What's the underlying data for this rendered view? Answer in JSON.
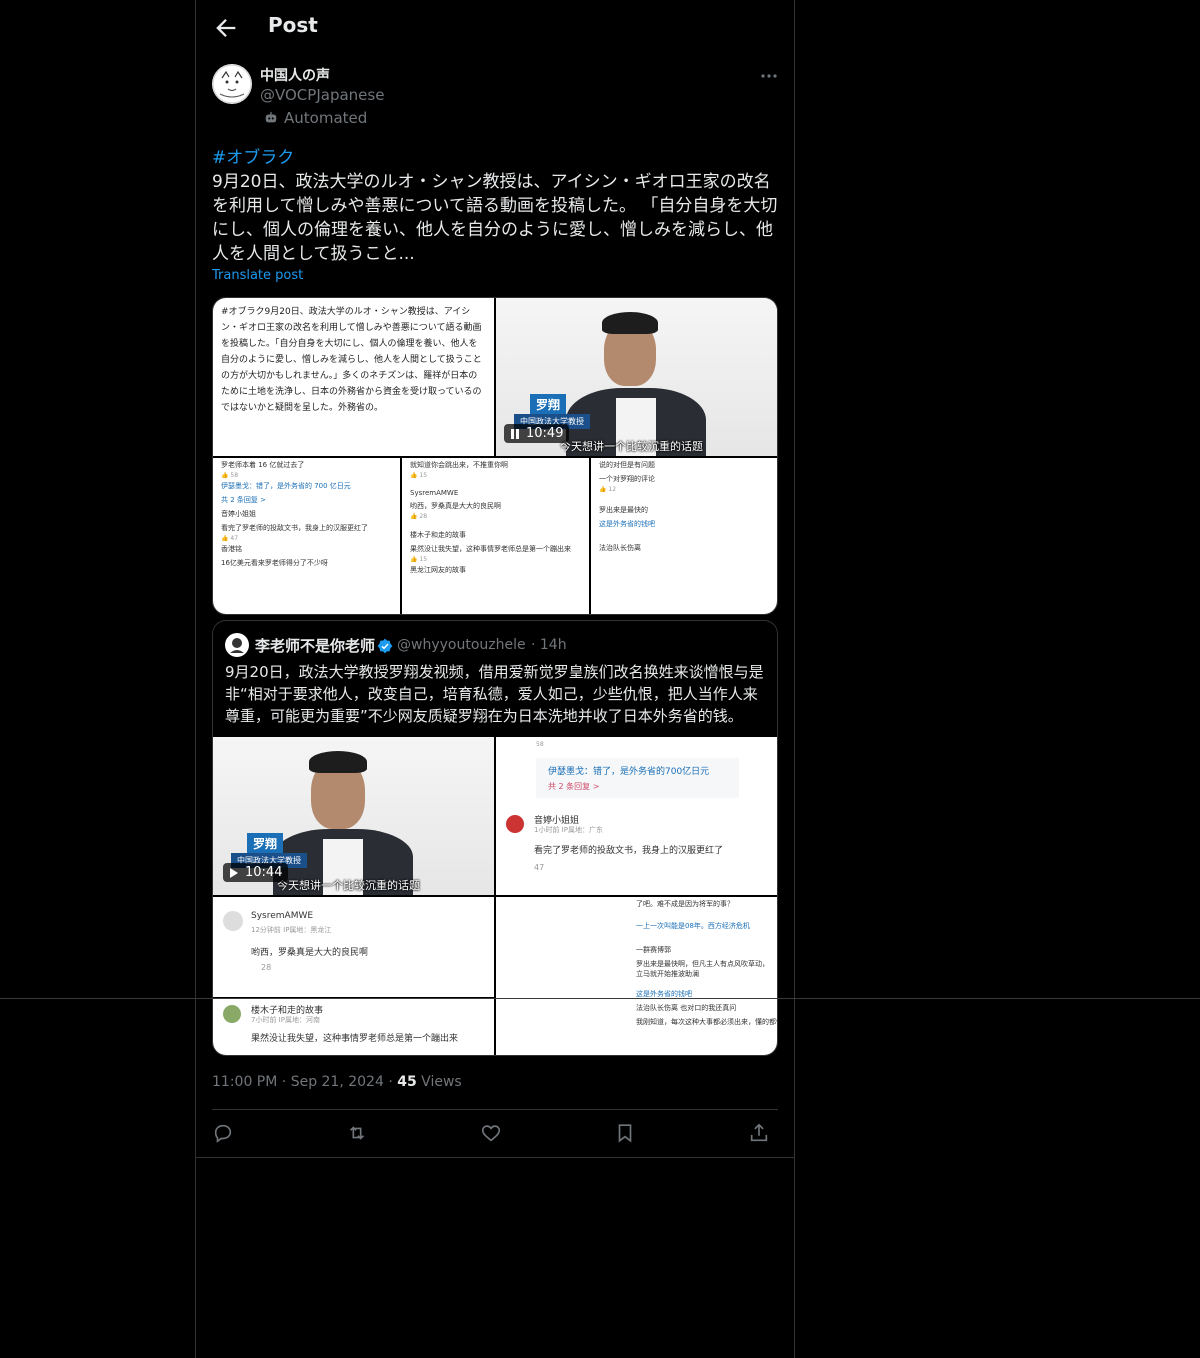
{
  "header": {
    "title": "Post"
  },
  "author": {
    "name": "中国人の声",
    "handle": "@VOCPJapanese",
    "automated_label": "Automated"
  },
  "post": {
    "hashtag": "#オブラク",
    "text": "9月20日、政法大学のルオ・シャン教授は、アイシン・ギオロ王家の改名を利用して憎しみや善悪について語る動画を投稿した。 「自分自身を大切にし、個人の倫理を養い、他人を自分のように愛し、憎しみを減らし、他人を人間として扱うこと...",
    "translate_label": "Translate post"
  },
  "media": {
    "doc_text": "#オブラク9月20日、政法大学のルオ・シャン教授は、アイシン・ギオロ王家の改名を利用して憎しみや善悪について語る動画を投稿した。「自分自身を大切にし、個人の倫理を養い、他人を自分のように愛し、憎しみを減らし、他人を人間として扱うことの方が大切かもしれません。」多くのネチズンは、羅祥が日本のために土地を洗浄し、日本の外務省から資金を受け取っているのではないかと疑問を呈した。外務省の。",
    "video_badge": "罗翔",
    "video_sub": "中国政法大学教授",
    "video_caption": "今天想讲一个比较沉重的话题",
    "video_time": "10:49",
    "comments_a": [
      "罗老师本着 16 亿就过去了",
      "伊瑟墨戈：错了，是外务省的 700 亿日元",
      "共 2 条回复 >",
      "音婷小姐姐",
      "看完了罗老师的投敌文书，我身上的汉服更红了",
      "香港铭",
      "16亿美元看来罗老师得分了不少呀"
    ],
    "comments_b": [
      "就知道你会跳出来，不推重你啊",
      "SysremAMWE",
      "哟西，罗桑真是大大的良民啊",
      "楼木子和走的故事",
      "果然没让我失望，这种事情罗老师总是第一个蹦出来",
      "黑龙江网友的故事"
    ],
    "comments_c": [
      "说的对但是有问题",
      "一个对罗翔的评论",
      "罗出来是最快的",
      "这是外务省的钱吧",
      "法治队长伤离"
    ]
  },
  "quote": {
    "name": "李老师不是你老师",
    "handle": "@whyyoutouzhele",
    "time": "· 14h",
    "text": "9月20日，政法大学教授罗翔发视频，借用爱新觉罗皇族们改名换姓来谈憎恨与是非“相对于要求他人，改变自己，培育私德，爱人如己，少些仇恨，把人当作人来尊重，可能更为重要”不少网友质疑罗翔在为日本洗地并收了日本外务省的钱。",
    "video_badge": "罗翔",
    "video_sub": "中国政法大学教授",
    "video_caption": "今天想讲一个比较沉重的话题",
    "video_time": "10:44",
    "c1_meta": "58",
    "c1_reply": "伊瑟墨戈：错了，是外务省的700亿日元",
    "c1_count": "共 2 条回复 >",
    "c1_user": "音婷小姐姐",
    "c1_time": "1小时前 IP属地：广东",
    "c1_text": "看完了罗老师的投敌文书，我身上的汉服更红了",
    "c1_likes": "47",
    "c2_user": "SysremAMWE",
    "c2_time": "12分钟前 IP属地：黑龙江",
    "c2_text": "哟西，罗桑真是大大的良民啊",
    "c2_likes": "28",
    "c3_user": "楼木子和走的故事",
    "c3_time": "7小时前 IP属地：河南",
    "c3_text": "果然没让我失望，这种事情罗老师总是第一个蹦出来",
    "c4_lines": [
      "了吧。难不成是因为将军的事？",
      "一上一次叫能是08年。西方经济危机",
      "一群赛博郭",
      "罗出来是最快啊，但凡主人有点风吹草动，立马就开始推波助澜",
      "这是外务省的钱吧",
      "法治队长伤离 也对口的我还真问",
      "我刚知道，每次这种大事都必须出来，懂的都懂"
    ]
  },
  "meta": {
    "time": "11:00 PM",
    "date": "Sep 21, 2024",
    "views_count": "45",
    "views_label": "Views",
    "sep": "·"
  },
  "colors": {
    "accent": "#1d9bf0",
    "muted": "#71767b",
    "text": "#e7e9ea",
    "background": "#000000",
    "border": "#2f3336"
  }
}
